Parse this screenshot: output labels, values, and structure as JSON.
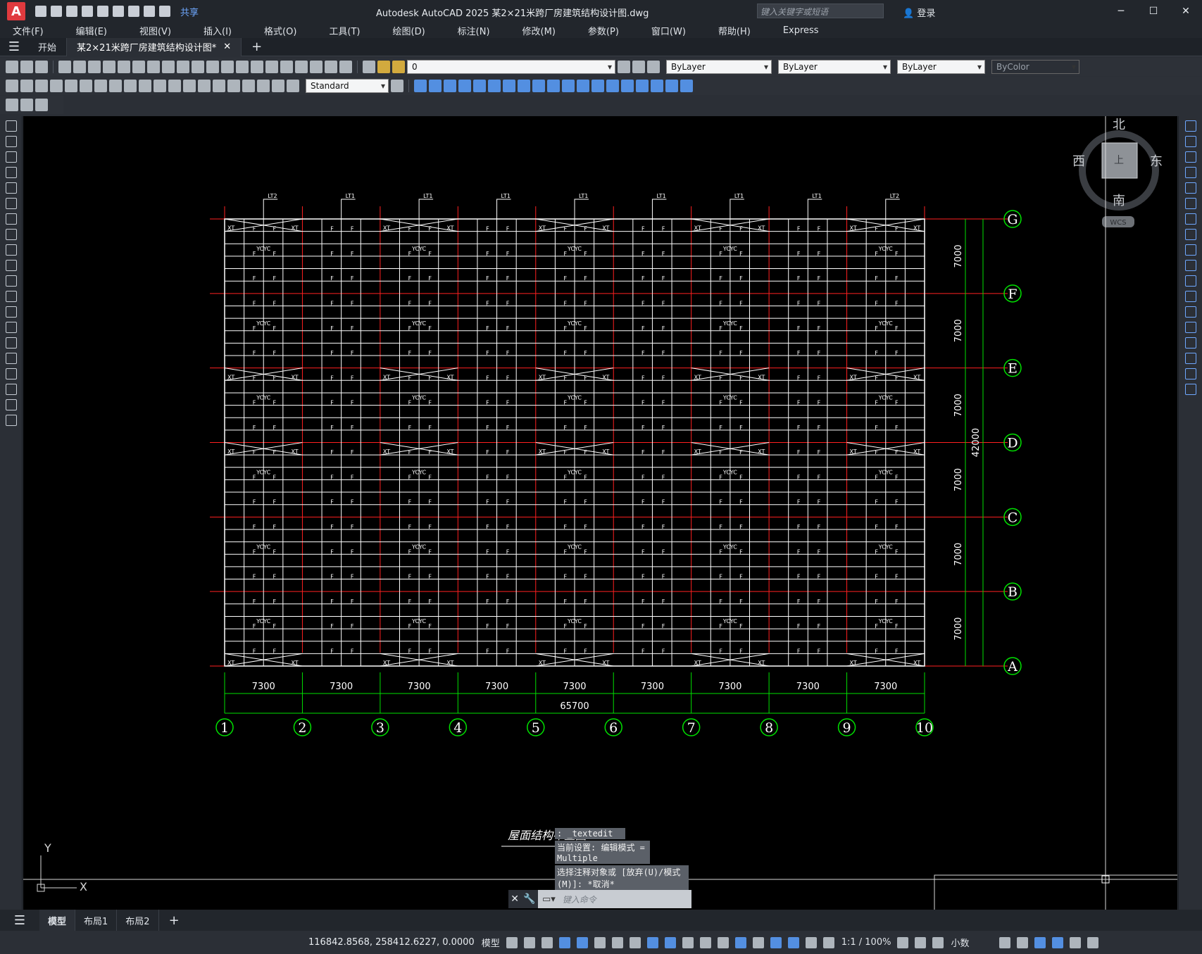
{
  "app": {
    "title": "Autodesk AutoCAD 2025    某2×21米跨厂房建筑结构设计图.dwg",
    "logo": "A",
    "share_label": "共享",
    "search_placeholder": "键入关键字或短语",
    "login_label": "登录"
  },
  "menu": [
    "文件(F)",
    "编辑(E)",
    "视图(V)",
    "插入(I)",
    "格式(O)",
    "工具(T)",
    "绘图(D)",
    "标注(N)",
    "修改(M)",
    "参数(P)",
    "窗口(W)",
    "帮助(H)",
    "Express"
  ],
  "tabs": {
    "start": "开始",
    "active": "某2×21米跨厂房建筑结构设计图*"
  },
  "toolbar": {
    "layer_value": "0",
    "color_value": "ByLayer",
    "linetype_value": "ByLayer",
    "lineweight_value": "ByLayer",
    "plotstyle_value": "ByColor",
    "dimstyle_value": "Standard"
  },
  "drawing": {
    "column_labels": [
      "1",
      "2",
      "3",
      "4",
      "5",
      "6",
      "7",
      "8",
      "9",
      "10"
    ],
    "row_labels": [
      "G",
      "F",
      "E",
      "D",
      "C",
      "B",
      "A"
    ],
    "bay_dimension": "7300",
    "total_width": "65700",
    "span_dimension": "7000",
    "total_height": "42000",
    "top_labels": [
      "LT2",
      "LT1",
      "LT1",
      "LT1",
      "LT1",
      "LT1",
      "LT1",
      "LT1",
      "LT2"
    ],
    "title_text": "屋面结构布置图",
    "brace_label": "XT",
    "strut_label": "YC",
    "purlin_label": "F"
  },
  "viewcube": {
    "north": "北",
    "south": "南",
    "east": "东",
    "west": "西",
    "top": "上",
    "wcs": "WCS"
  },
  "ucs": {
    "x": "X",
    "y": "Y"
  },
  "command": {
    "line1": ": _textedit",
    "line2": "当前设置: 编辑模式 = Multiple",
    "line3": "选择注释对象或 [放弃(U)/模式(M)]: *取消*",
    "placeholder": "键入命令"
  },
  "layouts": [
    "模型",
    "布局1",
    "布局2"
  ],
  "status": {
    "coords": "116842.8568, 258412.6227, 0.0000",
    "model": "模型",
    "scale": "1:1 / 100%",
    "units": "小数"
  }
}
